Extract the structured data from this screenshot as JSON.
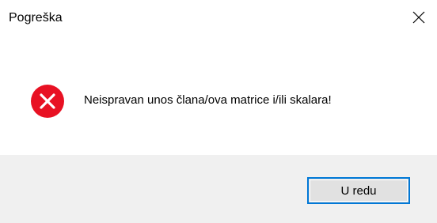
{
  "window": {
    "title": "Pogreška"
  },
  "titlebar": {
    "close_icon": "close-icon"
  },
  "content": {
    "icon": "error-icon",
    "icon_color": "#e81123",
    "message": "Neispravan unos člana/ova matrice i/ili skalara!"
  },
  "footer": {
    "ok_label": "U redu",
    "accent": "#0078d7"
  }
}
